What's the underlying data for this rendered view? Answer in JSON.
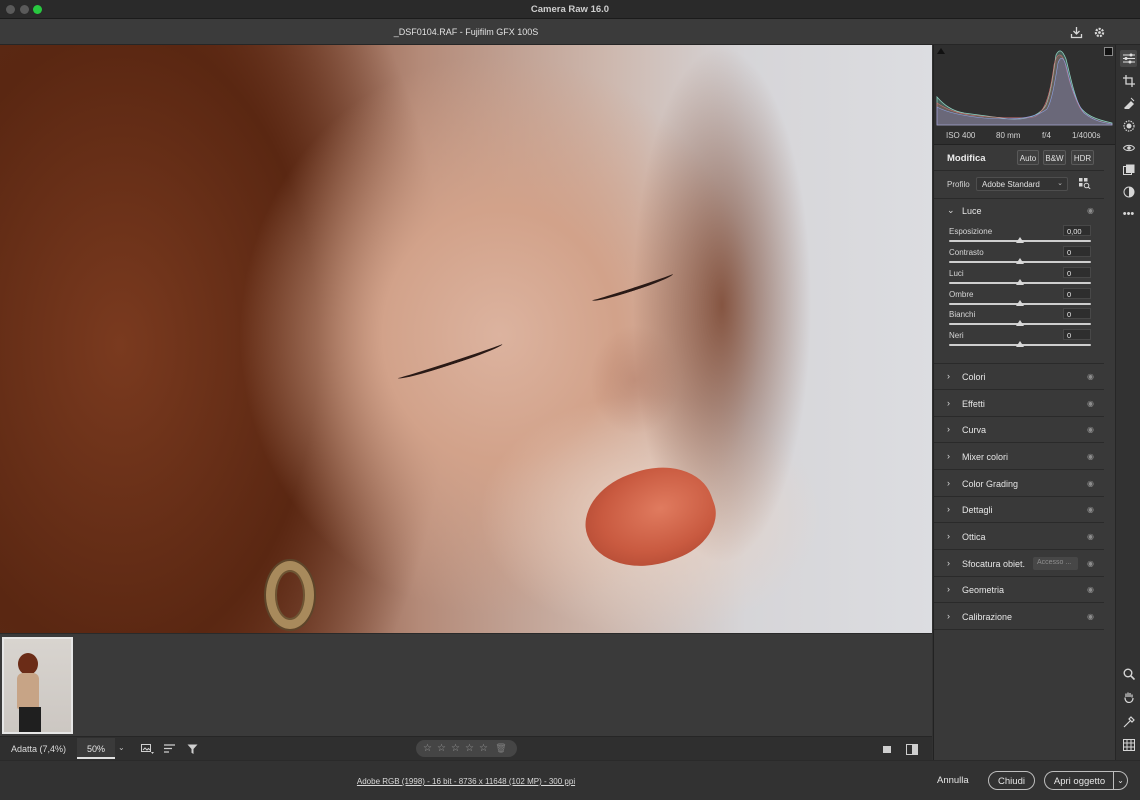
{
  "window": {
    "app_title": "Camera Raw 16.0"
  },
  "file": {
    "title": "_DSF0104.RAF  -  Fujifilm GFX 100S"
  },
  "header_icons": {
    "save": "save-icon",
    "settings": "gear-icon"
  },
  "histogram": {
    "exif": {
      "iso": "ISO 400",
      "focal": "80 mm",
      "aperture": "f/4",
      "shutter": "1/4000s"
    }
  },
  "edit": {
    "title": "Modifica",
    "buttons": {
      "auto": "Auto",
      "bw": "B&W",
      "hdr": "HDR"
    },
    "profile_label": "Profilo",
    "profile_value": "Adobe Standard"
  },
  "luce": {
    "label": "Luce",
    "sliders": [
      {
        "label": "Esposizione",
        "value": "0,00",
        "level": 0.5
      },
      {
        "label": "Contrasto",
        "value": "0",
        "level": 0.5
      },
      {
        "label": "Luci",
        "value": "0",
        "level": 0.5
      },
      {
        "label": "Ombre",
        "value": "0",
        "level": 0.5
      },
      {
        "label": "Bianchi",
        "value": "0",
        "level": 0.5
      },
      {
        "label": "Neri",
        "value": "0",
        "level": 0.5
      }
    ]
  },
  "sections": [
    {
      "label": "Colori"
    },
    {
      "label": "Effetti"
    },
    {
      "label": "Curva"
    },
    {
      "label": "Mixer colori"
    },
    {
      "label": "Color Grading"
    },
    {
      "label": "Dettagli"
    },
    {
      "label": "Ottica"
    },
    {
      "label": "Sfocatura obiet.",
      "badge": "Accesso ..."
    },
    {
      "label": "Geometria"
    },
    {
      "label": "Calibrazione"
    }
  ],
  "toolbar": {
    "zoom_fit": "Adatta (7,4%)",
    "zoom_pct": "50%",
    "rating": [
      "☆",
      "☆",
      "☆",
      "☆",
      "☆"
    ]
  },
  "footer": {
    "file_info": "Adobe RGB (1998) - 16 bit - 8736 x 11648 (102 MP) - 300 ppi",
    "cancel": "Annulla",
    "close": "Chiudi",
    "open": "Apri oggetto"
  },
  "colors": {
    "accent_green": "#28c840",
    "panel_bg": "#393939",
    "window_bg": "#323232"
  }
}
